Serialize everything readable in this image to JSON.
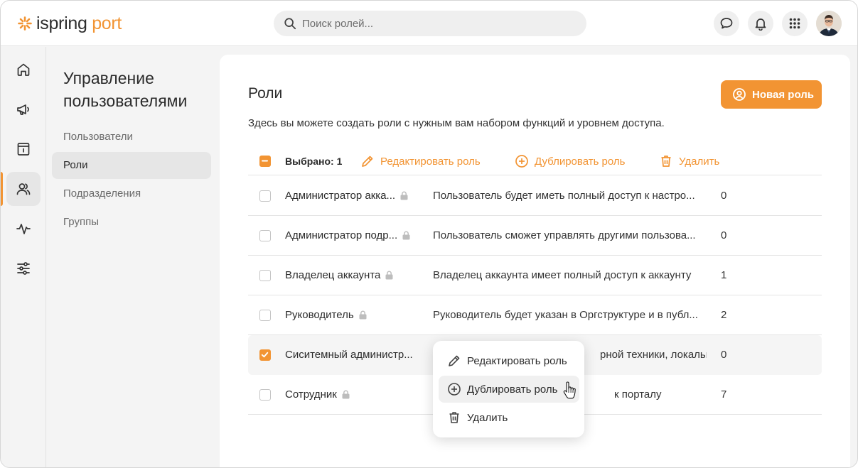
{
  "app": {
    "logo_main": "ispring",
    "logo_accent": " port",
    "accent_color": "#f29433"
  },
  "header": {
    "search_placeholder": "Поиск ролей...",
    "icons": [
      "search-icon",
      "chat-icon",
      "bell-icon",
      "apps-grid-icon",
      "user-avatar"
    ]
  },
  "rail": {
    "items": [
      "home-icon",
      "megaphone-icon",
      "info-book-icon",
      "users-icon",
      "activity-icon",
      "settings-sliders-icon"
    ],
    "active_index": 3
  },
  "section": {
    "title": "Управление пользователями",
    "items": [
      {
        "label": "Пользователи",
        "active": false
      },
      {
        "label": "Роли",
        "active": true
      },
      {
        "label": "Подразделения",
        "active": false
      },
      {
        "label": "Группы",
        "active": false
      }
    ]
  },
  "main": {
    "title": "Роли",
    "subtitle": "Здесь вы можете создать роли с нужным вам набором функций и уровнем доступа.",
    "new_button": "Новая роль",
    "bulk": {
      "selected_text": "Выбрано: 1",
      "edit": "Редактировать роль",
      "duplicate": "Дублировать роль",
      "delete": "Удалить"
    },
    "rows": [
      {
        "name": "Администратор акка...",
        "locked": true,
        "description": "Пользователь будет иметь полный доступ к настро...",
        "count": "0",
        "checked": false
      },
      {
        "name": "Администратор подр...",
        "locked": true,
        "description": "Пользователь сможет управлять другими пользова...",
        "count": "0",
        "checked": false
      },
      {
        "name": "Владелец аккаунта",
        "locked": true,
        "description": "Владелец аккаунта имеет полный доступ к аккаунту",
        "count": "1",
        "checked": false
      },
      {
        "name": "Руководитель",
        "locked": true,
        "description": "Руководитель будет указан в Оргструктуре и в публ...",
        "count": "2",
        "checked": false
      },
      {
        "name": "Сиситемный администр...",
        "locked": false,
        "description": "рной техники, локальн...",
        "count": "0",
        "checked": true
      },
      {
        "name": "Сотрудник",
        "locked": true,
        "description": "к порталу",
        "count": "7",
        "checked": false
      }
    ]
  },
  "context_menu": {
    "items": [
      {
        "label": "Редактировать роль",
        "icon": "pencil-icon"
      },
      {
        "label": "Дублировать роль",
        "icon": "plus-circle-icon",
        "hovered": true
      },
      {
        "label": "Удалить",
        "icon": "trash-icon"
      }
    ]
  }
}
